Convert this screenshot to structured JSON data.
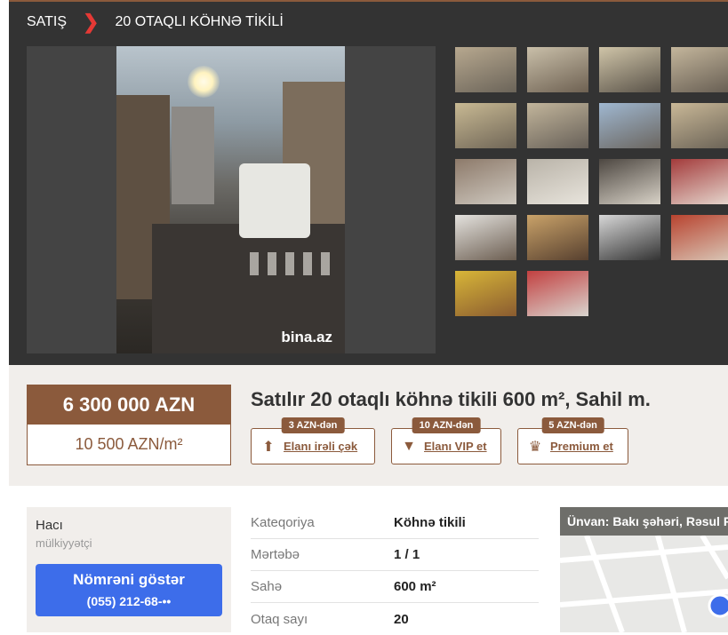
{
  "breadcrumb": {
    "root": "SATIŞ",
    "current": "20 OTAQLI KÖHNƏ TİKİLİ"
  },
  "gallery": {
    "watermark": "bina.az",
    "thumbnails": [
      {
        "c1": "#b7a88f",
        "c2": "#6b6459"
      },
      {
        "c1": "#c9bfa9",
        "c2": "#6e6152"
      },
      {
        "c1": "#cfc4a8",
        "c2": "#5a5349"
      },
      {
        "c1": "#c4b69c",
        "c2": "#665d52"
      },
      {
        "c1": "#c8b993",
        "c2": "#706657"
      },
      {
        "c1": "#c2b59b",
        "c2": "#676058"
      },
      {
        "c1": "#9fb7d0",
        "c2": "#6b6660"
      },
      {
        "c1": "#c9b897",
        "c2": "#6a6256"
      },
      {
        "c1": "#8d7a6a",
        "c2": "#cfc9c0"
      },
      {
        "c1": "#b9b3a8",
        "c2": "#e8e4dc"
      },
      {
        "c1": "#4d4741",
        "c2": "#d8d2c7"
      },
      {
        "c1": "#a33b3b",
        "c2": "#e6d8cf"
      },
      {
        "c1": "#e4e2de",
        "c2": "#6b5d50"
      },
      {
        "c1": "#c9a269",
        "c2": "#57402f"
      },
      {
        "c1": "#d7d7d7",
        "c2": "#333333"
      },
      {
        "c1": "#b8432f",
        "c2": "#d9c7b7"
      },
      {
        "c1": "#d8b638",
        "c2": "#8a5b30"
      },
      {
        "c1": "#c24040",
        "c2": "#d9d5cf"
      }
    ]
  },
  "listing": {
    "price": "6 300 000 AZN",
    "price_per_m2": "10 500 AZN/m²",
    "title": "Satılır 20 otaqlı köhnə tikili 600 m², Sahil m."
  },
  "actions": [
    {
      "label": "Elanı irəli çək",
      "tag": "3 AZN-dən",
      "icon": "arrow-up-icon"
    },
    {
      "label": "Elanı VIP et",
      "tag": "10 AZN-dən",
      "icon": "vip-icon"
    },
    {
      "label": "Premium et",
      "tag": "5 AZN-dən",
      "icon": "crown-icon"
    }
  ],
  "seller": {
    "name": "Hacı",
    "role": "mülkiyyətçi",
    "show_number": "Nömrəni göstər",
    "phone": "(055) 212-68-••"
  },
  "properties": [
    {
      "key": "Kateqoriya",
      "value": "Köhnə tikili"
    },
    {
      "key": "Mərtəbə",
      "value": "1 / 1"
    },
    {
      "key": "Sahə",
      "value": "600 m²"
    },
    {
      "key": "Otaq sayı",
      "value": "20"
    }
  ],
  "map": {
    "address": "Ünvan: Bakı şəhəri, Rəsul Rza"
  },
  "colors": {
    "accent": "#8b5a3c",
    "call_button": "#3d6dea",
    "dark_bg": "#333333"
  }
}
